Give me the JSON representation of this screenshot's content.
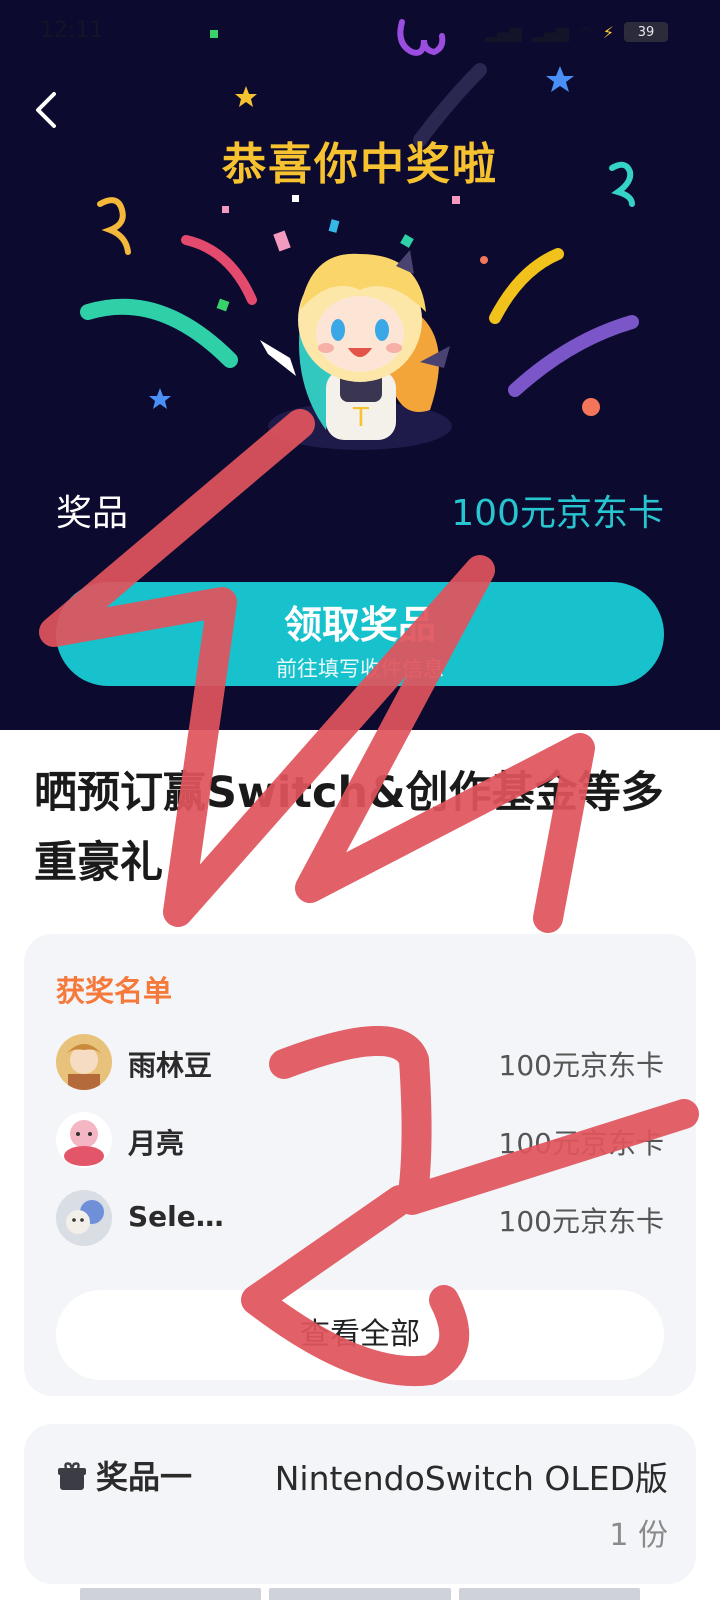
{
  "status_bar": {
    "time": "12:11",
    "battery": "39"
  },
  "hero": {
    "title": "恭喜你中奖啦",
    "prize_label": "奖品",
    "prize_value": "100元京东卡",
    "claim_button": "领取奖品",
    "claim_subtext": "前往填写收件信息"
  },
  "event": {
    "title": "晒预订赢Switch&创作基金等多重豪礼"
  },
  "winners": {
    "title": "获奖名单",
    "items": [
      {
        "name": "雨林豆",
        "prize": "100元京东卡"
      },
      {
        "name": "月亮",
        "prize": "100元京东卡"
      },
      {
        "name": "Sele…",
        "prize": "100元京东卡"
      }
    ],
    "view_all": "查看全部"
  },
  "prize_detail": {
    "label": "奖品一",
    "name": "NintendoSwitch OLED版",
    "quantity": "1 份"
  },
  "colors": {
    "hero_bg": "#0c0a2e",
    "title_yellow": "#f6c230",
    "accent_teal": "#17c2cc",
    "winners_orange": "#f4793b",
    "scribble_red": "#e0545c"
  }
}
